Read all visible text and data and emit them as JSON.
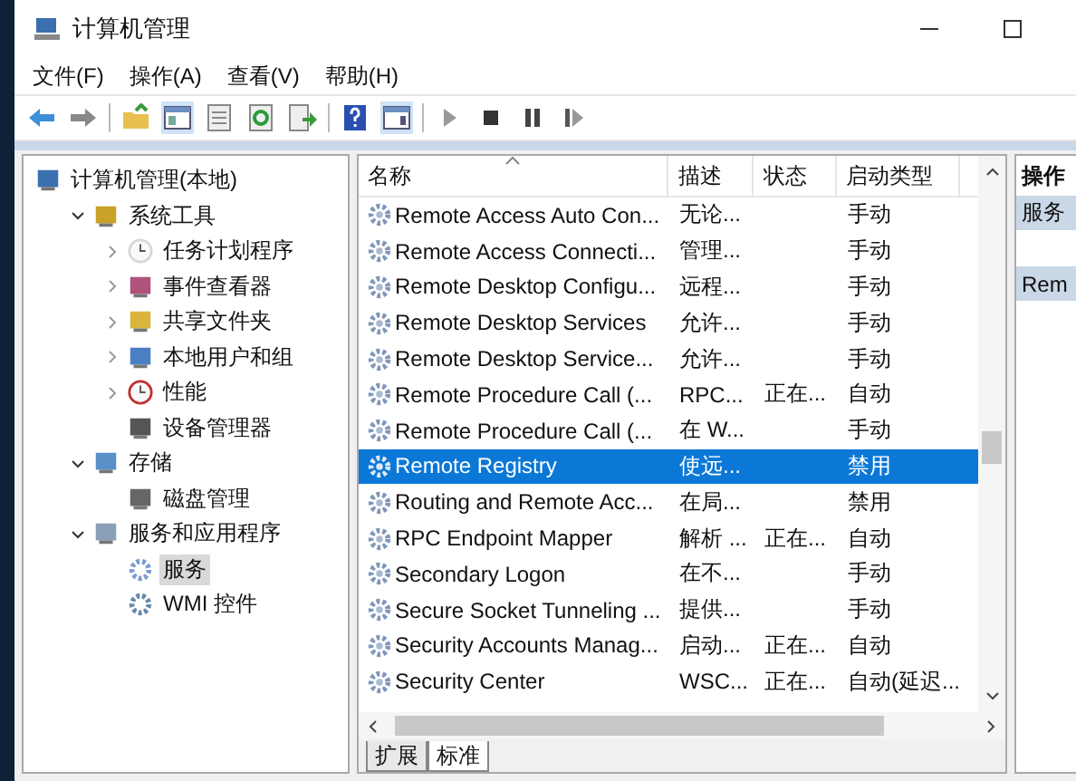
{
  "window": {
    "title": "计算机管理"
  },
  "menu": [
    "文件(F)",
    "操作(A)",
    "查看(V)",
    "帮助(H)"
  ],
  "tree": [
    {
      "label": "计算机管理(本地)",
      "kind": "computer",
      "selected": false,
      "children": [
        {
          "label": "系统工具",
          "kind": "tools",
          "expanded": true,
          "selected": false,
          "children": [
            {
              "label": "任务计划程序",
              "kind": "clock",
              "expanded": false,
              "selected": false
            },
            {
              "label": "事件查看器",
              "kind": "log",
              "expanded": false,
              "selected": false
            },
            {
              "label": "共享文件夹",
              "kind": "share",
              "expanded": false,
              "selected": false
            },
            {
              "label": "本地用户和组",
              "kind": "users",
              "expanded": false,
              "selected": false
            },
            {
              "label": "性能",
              "kind": "perf",
              "expanded": false,
              "selected": false
            },
            {
              "label": "设备管理器",
              "kind": "device",
              "selected": false
            }
          ]
        },
        {
          "label": "存储",
          "kind": "storage",
          "expanded": true,
          "selected": false,
          "children": [
            {
              "label": "磁盘管理",
              "kind": "disk",
              "selected": false
            }
          ]
        },
        {
          "label": "服务和应用程序",
          "kind": "apps",
          "expanded": true,
          "selected": false,
          "children": [
            {
              "label": "服务",
              "kind": "services",
              "selected": true
            },
            {
              "label": "WMI 控件",
              "kind": "wmi",
              "selected": false
            }
          ]
        }
      ]
    }
  ],
  "table": {
    "columns": [
      {
        "label": "名称",
        "sorted": true
      },
      {
        "label": "描述",
        "sorted": false
      },
      {
        "label": "状态",
        "sorted": false
      },
      {
        "label": "启动类型",
        "sorted": false
      }
    ],
    "rows": [
      {
        "name": "Remote Access Auto Con...",
        "description": "无论...",
        "startup": "手动",
        "selected": false
      },
      {
        "name": "Remote Access Connecti...",
        "description": "管理...",
        "startup": "手动",
        "selected": false
      },
      {
        "name": "Remote Desktop Configu...",
        "description": "远程...",
        "startup": "手动",
        "selected": false
      },
      {
        "name": "Remote Desktop Services",
        "description": "允许...",
        "startup": "手动",
        "selected": false
      },
      {
        "name": "Remote Desktop Service...",
        "description": "允许...",
        "startup": "手动",
        "selected": false
      },
      {
        "name": "Remote Procedure Call (...",
        "description": "RPC...",
        "status": "正在...",
        "startup": "自动",
        "selected": false
      },
      {
        "name": "Remote Procedure Call (...",
        "description": "在 W...",
        "startup": "手动",
        "selected": false
      },
      {
        "name": "Remote Registry",
        "description": "使远...",
        "startup": "禁用",
        "selected": true
      },
      {
        "name": "Routing and Remote Acc...",
        "description": "在局...",
        "startup": "禁用",
        "selected": false
      },
      {
        "name": "RPC Endpoint Mapper",
        "description": "解析 ...",
        "status": "正在...",
        "startup": "自动",
        "selected": false
      },
      {
        "name": "Secondary Logon",
        "description": "在不...",
        "startup": "手动",
        "selected": false
      },
      {
        "name": "Secure Socket Tunneling ...",
        "description": "提供...",
        "startup": "手动",
        "selected": false
      },
      {
        "name": "Security Accounts Manag...",
        "description": "启动...",
        "status": "正在...",
        "startup": "自动",
        "selected": false
      },
      {
        "name": "Security Center",
        "description": "WSC...",
        "status": "正在...",
        "startup": "自动(延迟...",
        "selected": false
      }
    ]
  },
  "view_tabs": [
    {
      "label": "扩展",
      "selected": false
    },
    {
      "label": "标准",
      "selected": true
    }
  ],
  "actions": {
    "title": "操作",
    "sections": [
      "服务",
      "Rem"
    ]
  }
}
